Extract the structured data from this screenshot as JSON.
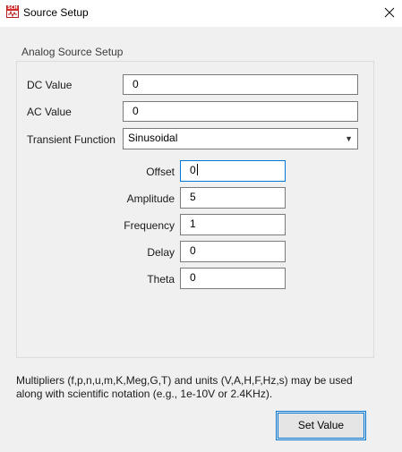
{
  "window": {
    "title": "Source Setup",
    "icon_label": "SCH"
  },
  "group": {
    "label": "Analog Source Setup"
  },
  "dc": {
    "label": "DC Value",
    "value": "0"
  },
  "ac": {
    "label": "AC Value",
    "value": "0"
  },
  "transient": {
    "label": "Transient Function",
    "selected": "Sinusoidal"
  },
  "params": {
    "offset": {
      "label": "Offset",
      "value": "0"
    },
    "amplitude": {
      "label": "Amplitude",
      "value": "5"
    },
    "frequency": {
      "label": "Frequency",
      "value": "1"
    },
    "delay": {
      "label": "Delay",
      "value": "0"
    },
    "theta": {
      "label": "Theta",
      "value": "0"
    }
  },
  "help": {
    "line1": "Multipliers (f,p,n,u,m,K,Meg,G,T) and units (V,A,H,F,Hz,s) may be used",
    "line2": "along with scientific notation (e.g., 1e-10V or 2.4KHz)."
  },
  "buttons": {
    "set_value": "Set Value"
  },
  "colors": {
    "accent": "#0078d7",
    "background": "#f0f0f0",
    "icon_red": "#d42a2a"
  }
}
